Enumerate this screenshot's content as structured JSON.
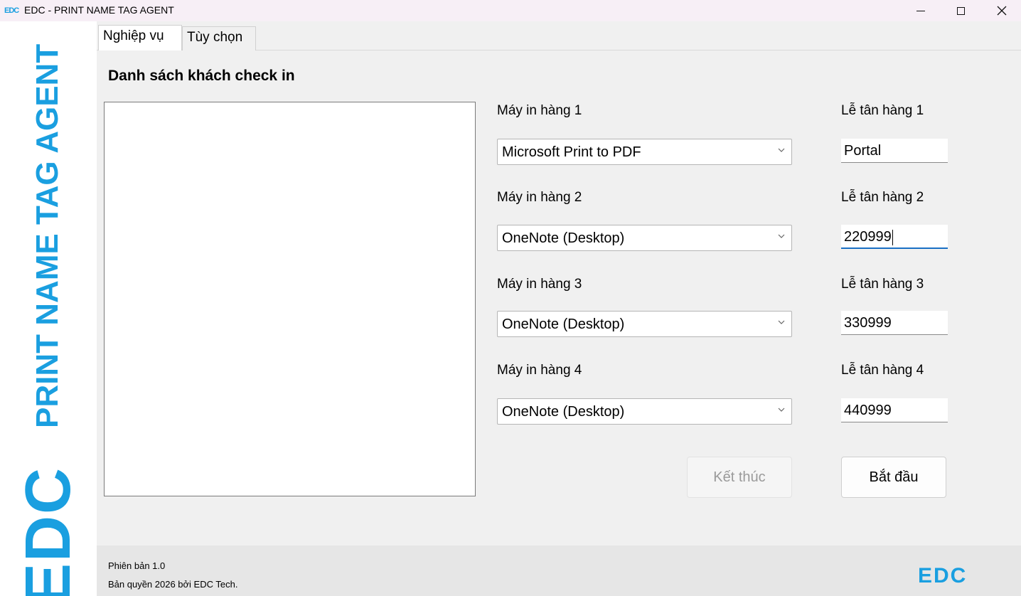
{
  "window": {
    "icon_text": "EDC",
    "title": "EDC - PRINT NAME TAG AGENT"
  },
  "sidebar": {
    "vertical_title": "PRINT NAME TAG AGENT",
    "logo": "EDC"
  },
  "tabs": [
    {
      "label": "Nghiệp vụ",
      "active": true
    },
    {
      "label": "Tùy chọn",
      "active": false
    }
  ],
  "main": {
    "section_title": "Danh sách khách check in",
    "rows": [
      {
        "printer_label": "Máy in hàng 1",
        "printer_value": "Microsoft Print to PDF",
        "reception_label": "Lễ tân hàng 1",
        "reception_value": "Portal"
      },
      {
        "printer_label": "Máy in hàng 2",
        "printer_value": "OneNote (Desktop)",
        "reception_label": "Lễ tân hàng 2",
        "reception_value": "220999"
      },
      {
        "printer_label": "Máy in hàng 3",
        "printer_value": "OneNote (Desktop)",
        "reception_label": "Lễ tân hàng 3",
        "reception_value": "330999"
      },
      {
        "printer_label": "Máy in hàng 4",
        "printer_value": "OneNote (Desktop)",
        "reception_label": "Lễ tân hàng 4",
        "reception_value": "440999"
      }
    ],
    "stop_button": "Kết thúc",
    "start_button": "Bắt đầu"
  },
  "footer": {
    "version": "Phiên bản 1.0",
    "copyright": "Bản quyền 2026 bởi EDC Tech.",
    "logo": "EDC"
  },
  "colors": {
    "brand": "#1a9fe0",
    "focus": "#1a6fc4"
  }
}
